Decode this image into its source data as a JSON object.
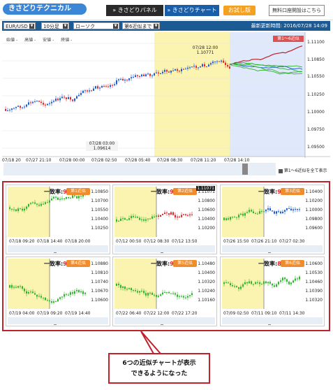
{
  "nav": {
    "logo": "きさどりテクニカル",
    "tab_panel": "» きさどりパネル",
    "tab_chart": "» きさどりチャート",
    "trial": "お試し版",
    "account": "無料口座開設はこちら"
  },
  "toolbar": {
    "pair": "EUR/USD",
    "interval": "10分足",
    "chart_type": "ローソク",
    "approx": "第6近似まで",
    "update_label": "最新更新時間: 2016/07/28 14:09"
  },
  "main_chart": {
    "ohlc_labels": [
      "始値 -",
      "高値 -",
      "安値 -",
      "終値 -"
    ],
    "forecast_label": "第1～6近似",
    "yaxis": [
      "1.11100",
      "1.10850",
      "1.10550",
      "1.10250",
      "1.10000",
      "1.09750",
      "1.09500"
    ],
    "xaxis": [
      "07/18 20",
      "07/27 21:10",
      "07/28 00:00",
      "07/28 02:50",
      "07/28 05:40",
      "07/28 08:30",
      "07/28 11:20",
      "07/28 14:10"
    ],
    "annot_high": [
      "07/28 12:00",
      "1.10771"
    ],
    "annot_low": [
      "07/28 03:00",
      "1.09614"
    ],
    "show_all": "第1～6近似を全て表示",
    "colors": {
      "highlight": "#fbf3b0",
      "forecast_bg": "#dfe9fb",
      "bull": "#1b5bd6",
      "bear": "#e0262b"
    }
  },
  "approximations": [
    {
      "rate": "95.12%",
      "badge": "第1近似",
      "y": [
        "1.10850",
        "1.10700",
        "1.10550",
        "1.10400",
        "1.10250"
      ],
      "x": [
        "07/18 09:20",
        "07/18 14:40",
        "07/18 20:00"
      ],
      "color": "#2fb52c",
      "tag": ""
    },
    {
      "rate": "93.31%",
      "badge": "第2近似",
      "y": [
        "1.11071",
        "1.10800",
        "1.10600",
        "1.10400",
        "1.10200"
      ],
      "x": [
        "07/12 00:50",
        "07/12 08:30",
        "07/12 13:50"
      ],
      "color": "#d9262b",
      "tag": "1.11071"
    },
    {
      "rate": "92.77%",
      "badge": "第3近似",
      "y": [
        "1.10400",
        "1.10200",
        "1.10000",
        "1.09800",
        "1.09600"
      ],
      "x": [
        "07/26 15:50",
        "07/26 21:10",
        "07/27 02:30"
      ],
      "color": "#1b5bd6",
      "tag": ""
    },
    {
      "rate": "92.19%",
      "badge": "第4近似",
      "y": [
        "1.10880",
        "1.10810",
        "1.10740",
        "1.10670",
        "1.10600"
      ],
      "x": [
        "07/19 04:00",
        "07/19 09:20",
        "07/19 14:40"
      ],
      "color": "#2fb52c",
      "tag": ""
    },
    {
      "rate": "90.35%",
      "badge": "第5近似",
      "y": [
        "1.10480",
        "1.10400",
        "1.10320",
        "1.10240",
        "1.10160"
      ],
      "x": [
        "07/22 06:40",
        "07/22 12:00",
        "07/22 17:20"
      ],
      "color": "#2fb52c",
      "tag": ""
    },
    {
      "rate": "88.60%",
      "badge": "第6近似",
      "y": [
        "1.10600",
        "1.10530",
        "1.10460",
        "1.10390",
        "1.10320"
      ],
      "x": [
        "07/09 02:50",
        "07/11 09:10",
        "07/11 14:30"
      ],
      "color": "#2fb52c",
      "tag": ""
    }
  ],
  "common": {
    "rate_label": "一致率:"
  },
  "callout": {
    "line1": "6つの近似チャートが表示",
    "line2": "できるようになった"
  }
}
